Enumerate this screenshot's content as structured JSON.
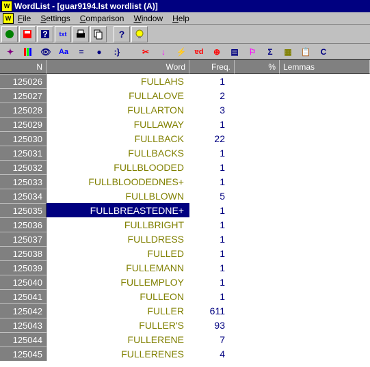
{
  "title": "WordList - [guar9194.lst wordlist (A)]",
  "menu": {
    "file": "File",
    "settings": "Settings",
    "comparison": "Comparison",
    "window": "Window",
    "help": "Help"
  },
  "toolbar_icons": [
    "record",
    "save",
    "help-book",
    "txt",
    "print",
    "copy",
    "question",
    "bulb"
  ],
  "toolbar2_icons": [
    "star",
    "columns",
    "eye",
    "Aa",
    "equals",
    "dot",
    "brackets",
    "scissors",
    "arrow-down",
    "bolt",
    "strike",
    "target",
    "list",
    "flag",
    "sigma",
    "chart",
    "clipboard",
    "C"
  ],
  "columns": {
    "n": "N",
    "word": "Word",
    "freq": "Freq.",
    "pct": "%",
    "lemmas": "Lemmas"
  },
  "selected_index": 9,
  "rows": [
    {
      "n": "125026",
      "word": "FULLAHS",
      "freq": "1"
    },
    {
      "n": "125027",
      "word": "FULLALOVE",
      "freq": "2"
    },
    {
      "n": "125028",
      "word": "FULLARTON",
      "freq": "3"
    },
    {
      "n": "125029",
      "word": "FULLAWAY",
      "freq": "1"
    },
    {
      "n": "125030",
      "word": "FULLBACK",
      "freq": "22"
    },
    {
      "n": "125031",
      "word": "FULLBACKS",
      "freq": "1"
    },
    {
      "n": "125032",
      "word": "FULLBLOODED",
      "freq": "1"
    },
    {
      "n": "125033",
      "word": "FULLBLOODEDNES+",
      "freq": "1"
    },
    {
      "n": "125034",
      "word": "FULLBLOWN",
      "freq": "5"
    },
    {
      "n": "125035",
      "word": "FULLBREASTEDNE+",
      "freq": "1"
    },
    {
      "n": "125036",
      "word": "FULLBRIGHT",
      "freq": "1"
    },
    {
      "n": "125037",
      "word": "FULLDRESS",
      "freq": "1"
    },
    {
      "n": "125038",
      "word": "FULLED",
      "freq": "1"
    },
    {
      "n": "125039",
      "word": "FULLEMANN",
      "freq": "1"
    },
    {
      "n": "125040",
      "word": "FULLEMPLOY",
      "freq": "1"
    },
    {
      "n": "125041",
      "word": "FULLEON",
      "freq": "1"
    },
    {
      "n": "125042",
      "word": "FULLER",
      "freq": "611"
    },
    {
      "n": "125043",
      "word": "FULLER'S",
      "freq": "93"
    },
    {
      "n": "125044",
      "word": "FULLERENE",
      "freq": "7"
    },
    {
      "n": "125045",
      "word": "FULLERENES",
      "freq": "4"
    }
  ]
}
